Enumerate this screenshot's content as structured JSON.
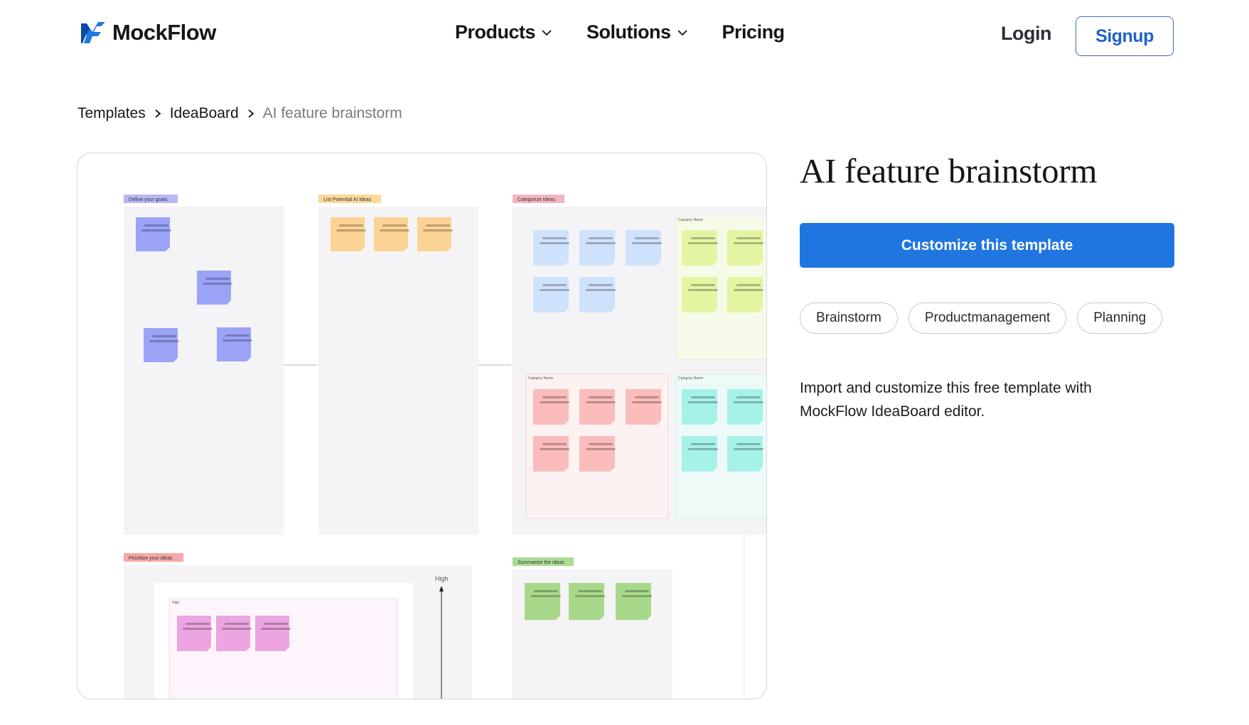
{
  "header": {
    "brand": "MockFlow",
    "nav": [
      {
        "label": "Products",
        "has_dropdown": true
      },
      {
        "label": "Solutions",
        "has_dropdown": true
      },
      {
        "label": "Pricing",
        "has_dropdown": false
      }
    ],
    "login_label": "Login",
    "signup_label": "Signup"
  },
  "breadcrumb": {
    "items": [
      "Templates",
      "IdeaBoard"
    ],
    "current": "AI feature brainstorm"
  },
  "preview": {
    "sections": {
      "goals": "Define your goals",
      "list": "List Potential AI Ideas",
      "categorize": "Categorize Ideas",
      "prioritize": "Prioritize your ideas",
      "summarize": "Summarize the ideas"
    },
    "category_label": "Category Name",
    "axis_high": "High",
    "quadrant_high": "High"
  },
  "template": {
    "title": "AI feature brainstorm",
    "cta_label": "Customize this template",
    "tags": [
      "Brainstorm",
      "Productmanagement",
      "Planning"
    ],
    "description": "Import and customize this free template with MockFlow IdeaBoard editor."
  },
  "colors": {
    "brand_blue": "#1f76e0",
    "signup_border": "#3b6fb0"
  }
}
